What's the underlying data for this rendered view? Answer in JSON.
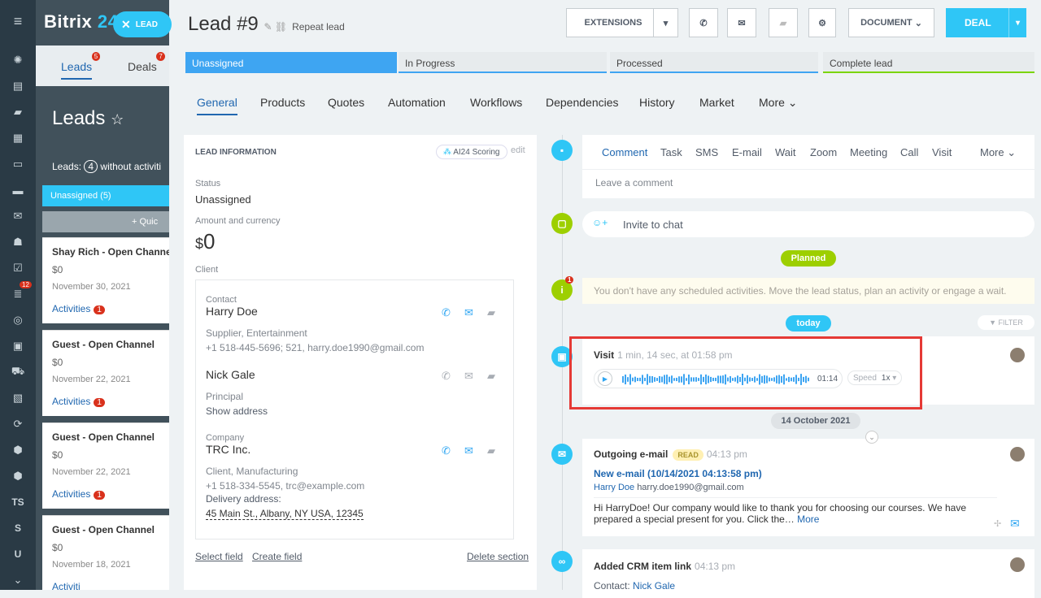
{
  "rail": {
    "items": [
      "swirl",
      "feed",
      "chat",
      "calendar",
      "docs",
      "drive",
      "mail",
      "groups",
      "tasks",
      "crm",
      "target",
      "sites",
      "shop",
      "contact",
      "sync",
      "box",
      "box2",
      "ts",
      "s",
      "u",
      "chevron"
    ],
    "badge": "12",
    "txt_ts": "TS",
    "txt_s": "S",
    "txt_u": "U"
  },
  "bg": {
    "brand": "Bitrix",
    "brand_num": "24",
    "tab_leads": "Leads",
    "tab_leads_badge": "5",
    "tab_deals": "Deals",
    "tab_deals_badge": "7",
    "title": "Leads",
    "stat": "Leads:",
    "stat_num": "4",
    "stat_rest": "without activiti",
    "column": "Unassigned",
    "column_count": "(5)",
    "quick": "+ Quic",
    "cards": [
      {
        "title": "Shay Rich - Open Channel",
        "price": "$0",
        "date": "November 30, 2021",
        "activity": "Activities",
        "count": "1"
      },
      {
        "title": "Guest - Open Channel",
        "price": "$0",
        "date": "November 22, 2021",
        "activity": "Activities",
        "count": "1"
      },
      {
        "title": "Guest - Open Channel",
        "price": "$0",
        "date": "November 22, 2021",
        "activity": "Activities",
        "count": "1"
      },
      {
        "title": "Guest - Open Channel",
        "price": "$0",
        "date": "November 18, 2021",
        "activity": "Activiti",
        "count": ""
      }
    ]
  },
  "leadtag": "LEAD",
  "header": {
    "title": "Lead",
    "num": "#9",
    "repeat": "Repeat lead",
    "ext": "EXTENSIONS",
    "doc": "DOCUMENT",
    "deal": "DEAL"
  },
  "stages": [
    "Unassigned",
    "In Progress",
    "Processed",
    "Complete lead"
  ],
  "tabs": [
    "General",
    "Products",
    "Quotes",
    "Automation",
    "Workflows",
    "Dependencies",
    "History",
    "Market",
    "More"
  ],
  "info": {
    "header": "LEAD INFORMATION",
    "ai": "AI24 Scoring",
    "edit": "edit",
    "status_label": "Status",
    "status": "Unassigned",
    "amount_label": "Amount and currency",
    "currency": "$",
    "amount": "0",
    "client_label": "Client",
    "contact_label": "Contact",
    "contact1": "Harry Doe",
    "contact1_sub": "Supplier, Entertainment",
    "contact1_info": "+1 518-445-5696; 521, harry.doe1990@gmail.com",
    "contact2": "Nick Gale",
    "contact2_sub": "Principal",
    "contact2_info": "Show address",
    "company_label": "Company",
    "company": "TRC Inc.",
    "company_sub": "Client, Manufacturing",
    "company_info": "+1 518-334-5545, trc@example.com",
    "delivery": "Delivery address:",
    "address": "45 Main St., Albany, NY USA, 12345",
    "select": "Select field",
    "create": "Create field",
    "delete": "Delete section"
  },
  "timeline": {
    "tabs": [
      "Comment",
      "Task",
      "SMS",
      "E-mail",
      "Wait",
      "Zoom",
      "Meeting",
      "Call",
      "Visit",
      "More"
    ],
    "leave": "Leave a comment",
    "invite": "Invite to chat",
    "planned": "Planned",
    "warn": "You don't have any scheduled activities. Move the lead status, plan an activity or engage a wait.",
    "warn_badge": "1",
    "today": "today",
    "filter": "FILTER",
    "visit_title": "Visit",
    "visit_meta": "1 min, 14 sec, at 01:58 pm",
    "visit_time": "01:14",
    "speed": "Speed",
    "speed_val": "1x",
    "date": "14 October 2021",
    "mail_title": "Outgoing e-mail",
    "mail_read": "READ",
    "mail_time": "04:13 pm",
    "mail_subject": "New e-mail (10/14/2021 04:13:58 pm)",
    "mail_from": "Harry Doe",
    "mail_addr": "harry.doe1990@gmail.com",
    "mail_body": "Hi HarryDoe! Our company would like to thank you for choosing our courses. We have prepared a special  present for you. Click the…",
    "mail_more": "More",
    "crm_title": "Added CRM item link",
    "crm_time": "04:13 pm",
    "crm_contact": "Contact:",
    "crm_name": "Nick Gale"
  },
  "colors": {
    "accent": "#2fc6f6",
    "blue": "#3ea5f2",
    "link": "#2067b0",
    "green": "#7bd500",
    "red": "#e53935"
  }
}
